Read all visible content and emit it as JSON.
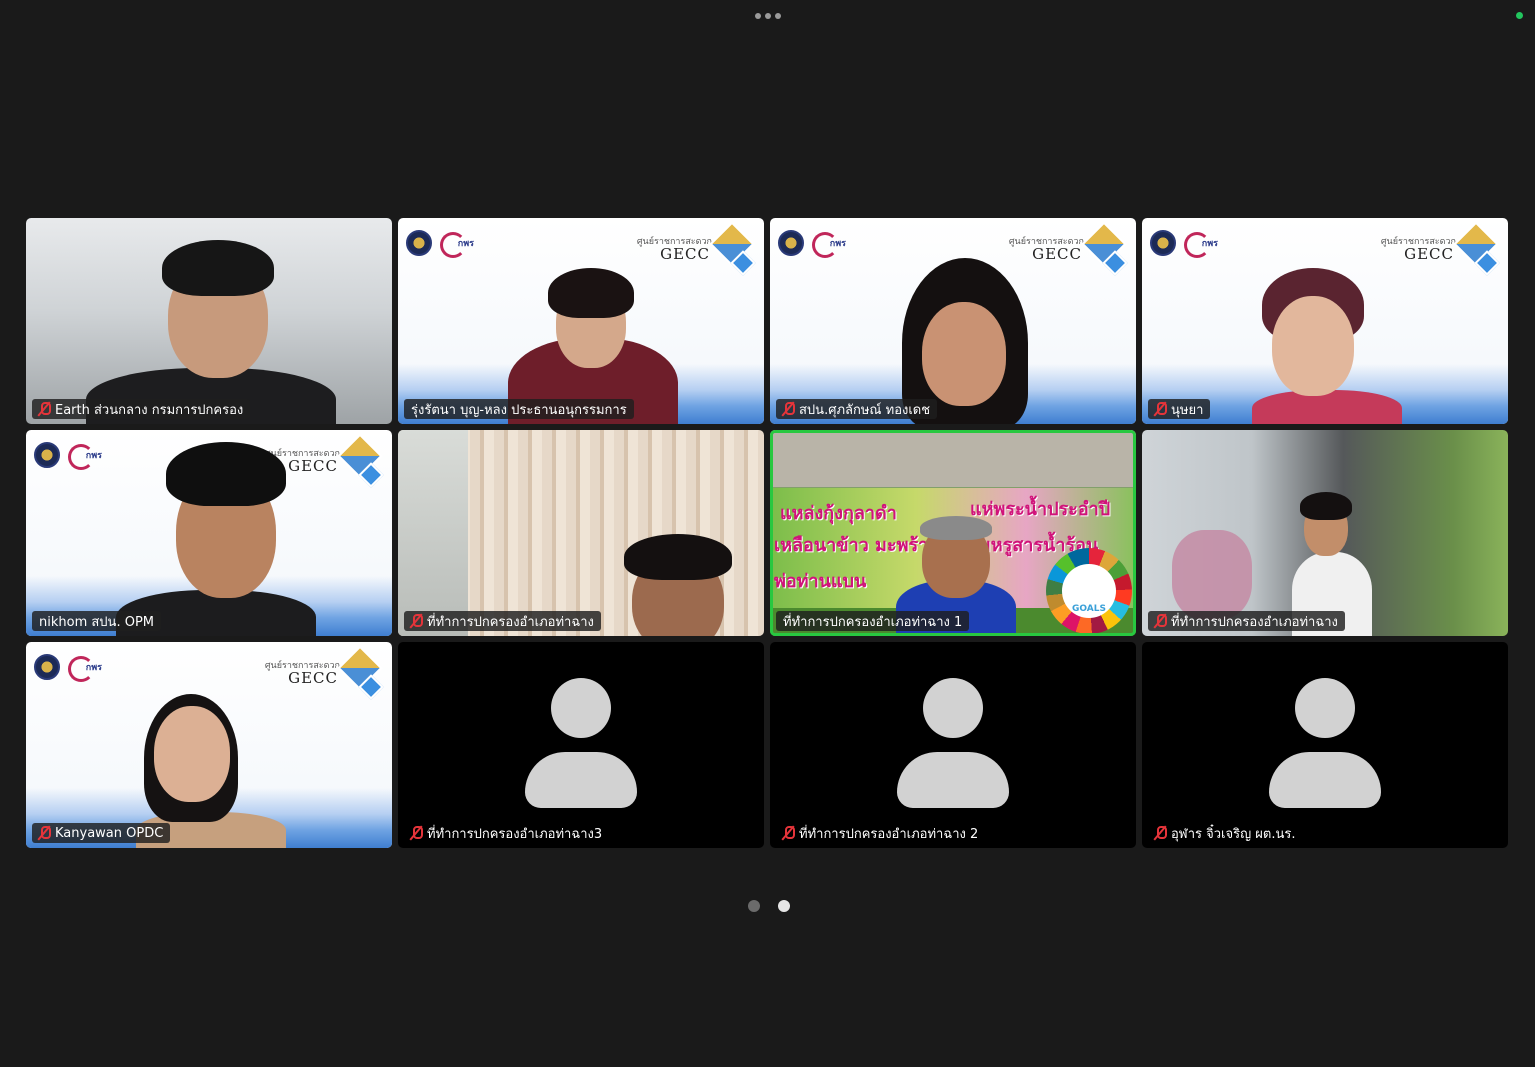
{
  "window": {
    "more_icon": "more-horizontal-icon",
    "status_color": "#22c55e"
  },
  "participants": [
    {
      "name": "Earth ส่วนกลาง กรมการปกครอง",
      "muted": true,
      "video": "on"
    },
    {
      "name": "รุ่งรัตนา บุญ-หลง ประธานอนุกรรมการ",
      "muted": false,
      "video": "on"
    },
    {
      "name": "สปน.ศุภลักษณ์ ทองเดช",
      "muted": true,
      "video": "on"
    },
    {
      "name": "นุษยา",
      "muted": true,
      "video": "on"
    },
    {
      "name": "nikhom สปน. OPM",
      "muted": false,
      "video": "on"
    },
    {
      "name": "ที่ทำการปกครองอำเภอท่าฉาง",
      "muted": true,
      "video": "on"
    },
    {
      "name": "ที่ทำการปกครองอำเภอท่าฉาง 1",
      "muted": false,
      "video": "on",
      "active_speaker": true
    },
    {
      "name": "ที่ทำการปกครองอำเภอท่าฉาง",
      "muted": true,
      "video": "on"
    },
    {
      "name": "Kanyawan OPDC",
      "muted": true,
      "video": "on"
    },
    {
      "name": "ที่ทำการปกครองอำเภอท่าฉาง3",
      "muted": true,
      "video": "off"
    },
    {
      "name": "ที่ทำการปกครองอำเภอท่าฉาง 2",
      "muted": true,
      "video": "off"
    },
    {
      "name": "อุฬาร จิ๋วเจริญ ผต.นร.",
      "muted": true,
      "video": "off"
    }
  ],
  "gecc": {
    "brand": "GECC",
    "thai": "ศูนย์ราชการสะดวก",
    "org": "กพร"
  },
  "sdg": {
    "text": "GOALS"
  },
  "banner": {
    "line1": "แหล่งกุ้งกุลาดำ",
    "line2": "แห่พระน้ำประอำปี",
    "line3": "เหลือนาข้าว มะพร้าว",
    "line4": "งามหรูสารน้ำร้อน",
    "line5": "พ่อท่านแบน"
  },
  "pagination": {
    "current_page": 2,
    "total_pages": 2
  },
  "colors": {
    "active_speaker_border": "#28c840",
    "muted_mic": "#e5343a",
    "background": "#1a1a1a"
  }
}
